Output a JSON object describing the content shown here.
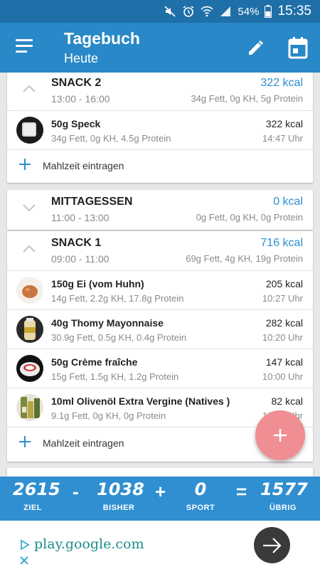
{
  "status_bar": {
    "battery": "54%",
    "time": "15:35"
  },
  "app_bar": {
    "title": "Tagebuch",
    "subtitle": "Heute"
  },
  "meals": {
    "snack2": {
      "name": "SNACK 2",
      "time": "13:00 - 16:00",
      "kcal": "322 kcal",
      "macros": "34g Fett, 0g KH, 5g Protein",
      "entries": [
        {
          "name": "50g Speck",
          "macros": "34g Fett, 0g KH, 4.5g Protein",
          "kcal": "322 kcal",
          "time": "14:47 Uhr"
        }
      ],
      "add_label": "Mahlzeit eintragen"
    },
    "mittagessen": {
      "name": "MITTAGESSEN",
      "time": "11:00 - 13:00",
      "kcal": "0 kcal",
      "macros": "0g Fett, 0g KH, 0g Protein"
    },
    "snack1": {
      "name": "SNACK 1",
      "time": "09:00 - 11:00",
      "kcal": "716 kcal",
      "macros": "69g Fett, 4g KH, 19g Protein",
      "entries": [
        {
          "name": "150g Ei (vom Huhn)",
          "macros": "14g Fett, 2.2g KH, 17.8g Protein",
          "kcal": "205 kcal",
          "time": "10:27 Uhr"
        },
        {
          "name": "40g Thomy Mayonnaise",
          "macros": "30.9g Fett, 0.5g KH, 0.4g Protein",
          "kcal": "282 kcal",
          "time": "10:20 Uhr"
        },
        {
          "name": "50g Crème fraîche",
          "macros": "15g Fett, 1.5g KH, 1.2g Protein",
          "kcal": "147 kcal",
          "time": "10:00 Uhr"
        },
        {
          "name": "10ml Olivenöl Extra Vergine (Natives )",
          "macros": "9.1g Fett, 0g KH, 0g Protein",
          "kcal": "82 kcal",
          "time": "10:00 Uhr"
        }
      ],
      "add_label": "Mahlzeit eintragen"
    }
  },
  "summary": {
    "goal": {
      "value": "2615",
      "label": "ZIEL"
    },
    "minus": "-",
    "so_far": {
      "value": "1038",
      "label": "BISHER"
    },
    "plus": "+",
    "sport": {
      "value": "0",
      "label": "SPORT"
    },
    "equals": "=",
    "remaining": {
      "value": "1577",
      "label": "ÜBRIG"
    }
  },
  "ad": {
    "url": "play.google.com"
  },
  "colors": {
    "primary": "#2988c7",
    "primary_dark": "#1f6fa8",
    "accent_blue": "#2b8fd0",
    "fab": "#ef8e93",
    "ad_text": "#1e8a8f"
  }
}
